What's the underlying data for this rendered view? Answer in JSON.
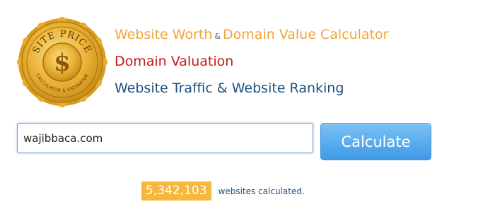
{
  "logo": {
    "arc_text": "SITE PRICE",
    "symbol": "$",
    "bottom_text": "CALCULATOR & ESTIMATOR",
    "colors": {
      "gold": "#e5a519",
      "gold_light": "#f7d36a",
      "gold_dark": "#b27710"
    }
  },
  "headlines": {
    "website_worth": "Website Worth",
    "ampersand": "&",
    "domain_value_calculator": "Domain Value Calculator",
    "domain_valuation": "Domain Valuation",
    "traffic_ranking": "Website Traffic & Website Ranking"
  },
  "search": {
    "value": "wajibbaca.com",
    "placeholder": ""
  },
  "calculate_button": {
    "label": "Calculate"
  },
  "stats": {
    "count": "5,342,103",
    "suffix": "websites calculated."
  },
  "colors": {
    "orange": "#f0a53c",
    "red": "#c01a1a",
    "blue": "#1d4f80",
    "button_blue": "#3f9ae6",
    "badge": "#f6b73c"
  }
}
